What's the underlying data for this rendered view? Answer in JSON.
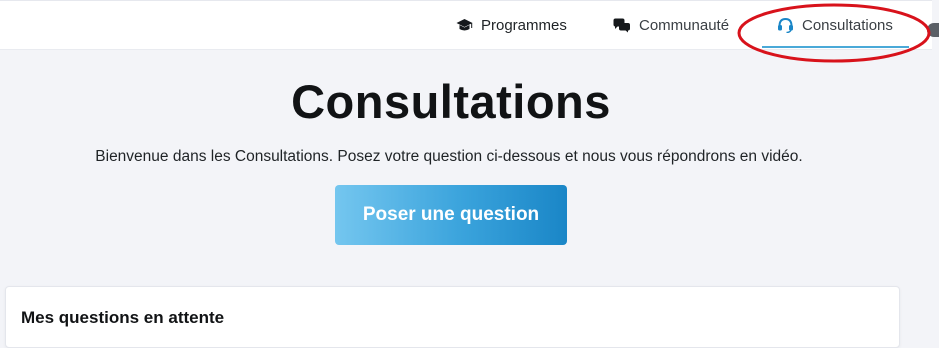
{
  "nav": {
    "items": [
      {
        "label": "Programmes",
        "icon": "graduation-cap-icon"
      },
      {
        "label": "Communauté",
        "icon": "comments-icon"
      },
      {
        "label": "Consultations",
        "icon": "headset-icon",
        "active": true
      }
    ]
  },
  "header": {
    "title": "Consultations",
    "subtitle": "Bienvenue dans les Consultations. Posez votre question ci-dessous et nous vous répondrons en vidéo."
  },
  "cta": {
    "label": "Poser une question"
  },
  "pending": {
    "title": "Mes questions en attente"
  },
  "colors": {
    "accent": "#1a86c7",
    "accent_light": "#74c6ef",
    "active_underline": "#4aa9d8",
    "annotation": "#d8121b",
    "background": "#f3f4f8"
  }
}
